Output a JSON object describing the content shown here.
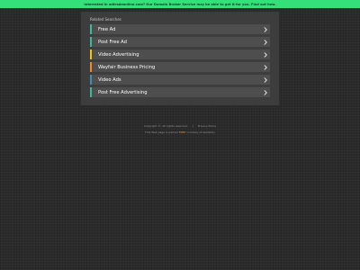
{
  "banner": {
    "text": "Interested in adtradeonline.com? Our Domain Broker Service may be able to get it for you. Find out how."
  },
  "related": {
    "heading": "Related Searches",
    "items": [
      {
        "label": "Free Ad",
        "accent": "#3db89a"
      },
      {
        "label": "Post Free Ad",
        "accent": "#3db89a"
      },
      {
        "label": "Video Advertising",
        "accent": "#f2c21b"
      },
      {
        "label": "Wayfair Business Pricing",
        "accent": "#f08a24"
      },
      {
        "label": "Video Ads",
        "accent": "#3e8fb0"
      },
      {
        "label": "Post Free Advertising",
        "accent": "#3db89a"
      }
    ]
  },
  "footer": {
    "copyright": "Copyright ©. All rights reserved.",
    "separator": "|",
    "privacy": "Privacy Policy",
    "parked_pre": "This Web page is parked",
    "parked_link": "FREE",
    "parked_post": "courtesy of GoDaddy"
  }
}
